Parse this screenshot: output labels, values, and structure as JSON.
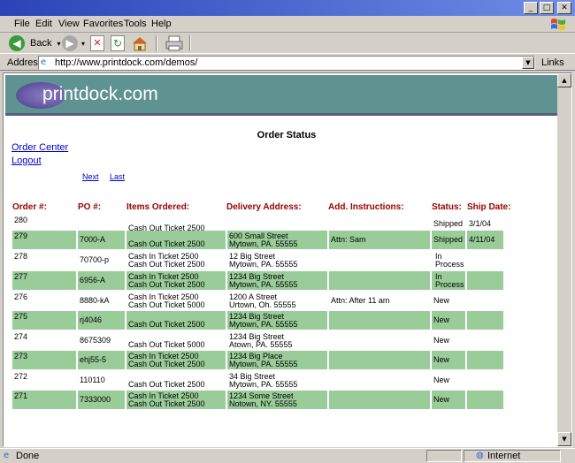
{
  "browser": {
    "menu": [
      "File",
      "Edit",
      "View",
      "Favorites",
      "Tools",
      "Help"
    ],
    "toolbar": {
      "back_label": "Back"
    },
    "address": {
      "label": "Address",
      "url": "http://www.printdock.com/demos/",
      "links_label": "Links"
    },
    "status": {
      "text": "Done",
      "zone": "Internet"
    }
  },
  "page": {
    "logo": "printdock.com",
    "title": "Order Status",
    "nav": {
      "order_center": "Order Center",
      "logout": "Logout",
      "next": "Next",
      "last": "Last"
    },
    "columns": [
      "Order #:",
      "PO #:",
      "Items Ordered:",
      "Delivery Address:",
      "Add. Instructions:",
      "Status:",
      "Ship Date:"
    ],
    "orders": [
      {
        "order": "280",
        "po": "",
        "items": [
          "",
          "Cash Out Ticket 2500"
        ],
        "address": [
          "",
          ""
        ],
        "instructions": "",
        "status": "Shipped",
        "ship": "3/1/04"
      },
      {
        "order": "279",
        "po": "7000-A",
        "items": [
          "",
          "Cash Out Ticket 2500"
        ],
        "address": [
          "600 Small Street",
          "Mytown, PA. 55555"
        ],
        "instructions": "Attn: Sam",
        "status": "Shipped",
        "ship": "4/11/04"
      },
      {
        "order": "278",
        "po": "70700-p",
        "items": [
          "Cash In Ticket 2500",
          "Cash Out Ticket 2500"
        ],
        "address": [
          "12 Big Street",
          "Mytown, PA. 55555"
        ],
        "instructions": "",
        "status": "In Process",
        "ship": ""
      },
      {
        "order": "277",
        "po": "6956-A",
        "items": [
          "Cash In Ticket 2500",
          "Cash Out Ticket 2500"
        ],
        "address": [
          "1234 Big Street",
          "Mytown, PA. 55555"
        ],
        "instructions": "",
        "status": "In Process",
        "ship": ""
      },
      {
        "order": "276",
        "po": "8880-kA",
        "items": [
          "Cash In Ticket 2500",
          "Cash Out Ticket 5000"
        ],
        "address": [
          "1200 A Street",
          "Urtown, Oh. 55555"
        ],
        "instructions": "Attn: After 11 am",
        "status": "New",
        "ship": ""
      },
      {
        "order": "275",
        "po": "rj4046",
        "items": [
          "",
          "Cash Out Ticket 2500"
        ],
        "address": [
          "1234 Big Street",
          "Mytown, PA. 55555"
        ],
        "instructions": "",
        "status": "New",
        "ship": ""
      },
      {
        "order": "274",
        "po": "8675309",
        "items": [
          "",
          "Cash Out Ticket 5000"
        ],
        "address": [
          "1234 Big Street",
          "Atown, PA. 55555"
        ],
        "instructions": "",
        "status": "New",
        "ship": ""
      },
      {
        "order": "273",
        "po": "ehj55-5",
        "items": [
          "Cash In Ticket 2500",
          "Cash Out Ticket 2500"
        ],
        "address": [
          "1234 Big Place",
          "Mytown, PA. 55555"
        ],
        "instructions": "",
        "status": "New",
        "ship": ""
      },
      {
        "order": "272",
        "po": "110110",
        "items": [
          "",
          "Cash Out Ticket 2500"
        ],
        "address": [
          "34 Big Street",
          "Mytown, PA. 55555"
        ],
        "instructions": "",
        "status": "New",
        "ship": ""
      },
      {
        "order": "271",
        "po": "7333000",
        "items": [
          "Cash In Ticket 2500",
          "Cash Out Ticket 2500"
        ],
        "address": [
          "1234 Some Street",
          "Notown, NY. 55555"
        ],
        "instructions": "",
        "status": "New",
        "ship": ""
      }
    ]
  },
  "colors": {
    "banner": "#5f9392",
    "row_green": "#99cc99",
    "header_red": "#990000",
    "link_blue": "#0000cc"
  }
}
